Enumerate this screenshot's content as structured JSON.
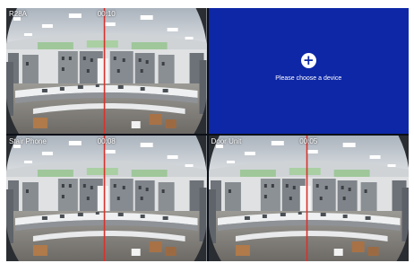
{
  "tiles": [
    {
      "label": "R28A",
      "time": "00:10"
    },
    {
      "empty": true,
      "add_icon": "+",
      "message": "Please choose a device"
    },
    {
      "label": "Stair Phone",
      "time": "00:08"
    },
    {
      "label": "Door Unit",
      "time": "00:05"
    }
  ],
  "colors": {
    "empty_tile_bg": "#0e27a7",
    "divider": "#0b0f18",
    "overlay_text": "#ffffff",
    "red_line": "#d8322c"
  }
}
